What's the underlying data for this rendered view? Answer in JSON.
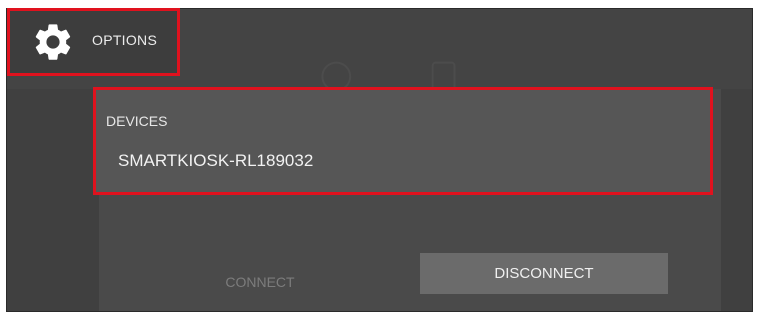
{
  "options": {
    "label": "OPTIONS",
    "icon": "gear-icon"
  },
  "devices": {
    "label": "DEVICES",
    "items": [
      "SMARTKIOSK-RL189032"
    ]
  },
  "actions": {
    "connect_label": "CONNECT",
    "disconnect_label": "DISCONNECT"
  },
  "colors": {
    "highlight": "#e0121e",
    "background": "#404040",
    "button": "#6b6b6b"
  }
}
